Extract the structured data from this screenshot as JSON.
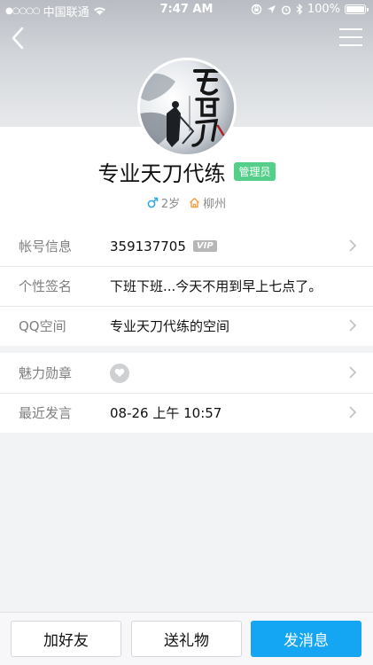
{
  "status_bar": {
    "carrier": "中国联通",
    "time": "7:47 AM",
    "battery": "100%",
    "signal_dots": "●○○○○"
  },
  "header": {
    "back_icon": "chevron-left-icon",
    "menu_icon": "hamburger-menu-icon"
  },
  "profile": {
    "nickname": "专业天刀代练",
    "badge": "管理员",
    "age": "2岁",
    "location": "柳州",
    "gender_icon": "male-icon",
    "home_icon": "home-icon",
    "gender_color": "#2aa8e8",
    "home_color": "#f0a040"
  },
  "info_rows": [
    {
      "label": "帐号信息",
      "value": "359137705",
      "tag": "VIP"
    },
    {
      "label": "个性签名",
      "value": "下班下班...今天不用到早上七点了。"
    },
    {
      "label": "QQ空间",
      "value": "专业天刀代练的空间"
    }
  ],
  "extra_rows": [
    {
      "label": "魅力勋章"
    },
    {
      "label": "最近发言",
      "value": "08-26 上午 10:57"
    }
  ],
  "actions": {
    "add_friend": "加好友",
    "send_gift": "送礼物",
    "send_message": "发消息"
  },
  "colors": {
    "accent": "#15a6f3",
    "badge": "#54cf8a"
  }
}
